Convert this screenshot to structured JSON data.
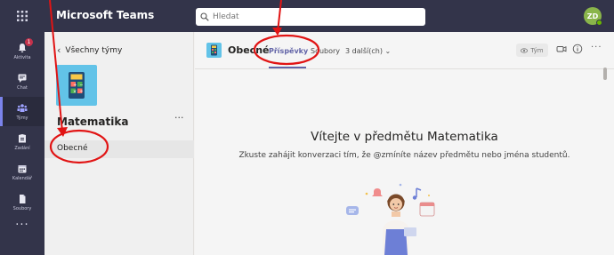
{
  "app": {
    "title": "Microsoft Teams"
  },
  "search": {
    "placeholder": "Hledat"
  },
  "user": {
    "initials": "ZD"
  },
  "rail": {
    "items": [
      {
        "label": "Aktivita",
        "badge": "1"
      },
      {
        "label": "Chat"
      },
      {
        "label": "Týmy"
      },
      {
        "label": "Zadání"
      },
      {
        "label": "Kalendář"
      },
      {
        "label": "Soubory"
      }
    ],
    "more": "..."
  },
  "teams": {
    "back_label": "Všechny týmy",
    "team_name": "Matematika",
    "more": "···",
    "channels": [
      {
        "label": "Obecné"
      }
    ]
  },
  "channel": {
    "title": "Obecné",
    "tabs": [
      {
        "label": "Příspěvky"
      },
      {
        "label": "Soubory"
      },
      {
        "label": "3 další(ch) ⌄"
      }
    ],
    "team_button": "Tým",
    "more": "···"
  },
  "welcome": {
    "title": "Vítejte v předmětu Matematika",
    "subtitle": "Zkuste zahájit konverzaci tím, že @zmíníte název předmětu nebo jména studentů."
  },
  "colors": {
    "accent": "#6264a7",
    "topbar": "#33344a",
    "annotation": "#e11414"
  }
}
